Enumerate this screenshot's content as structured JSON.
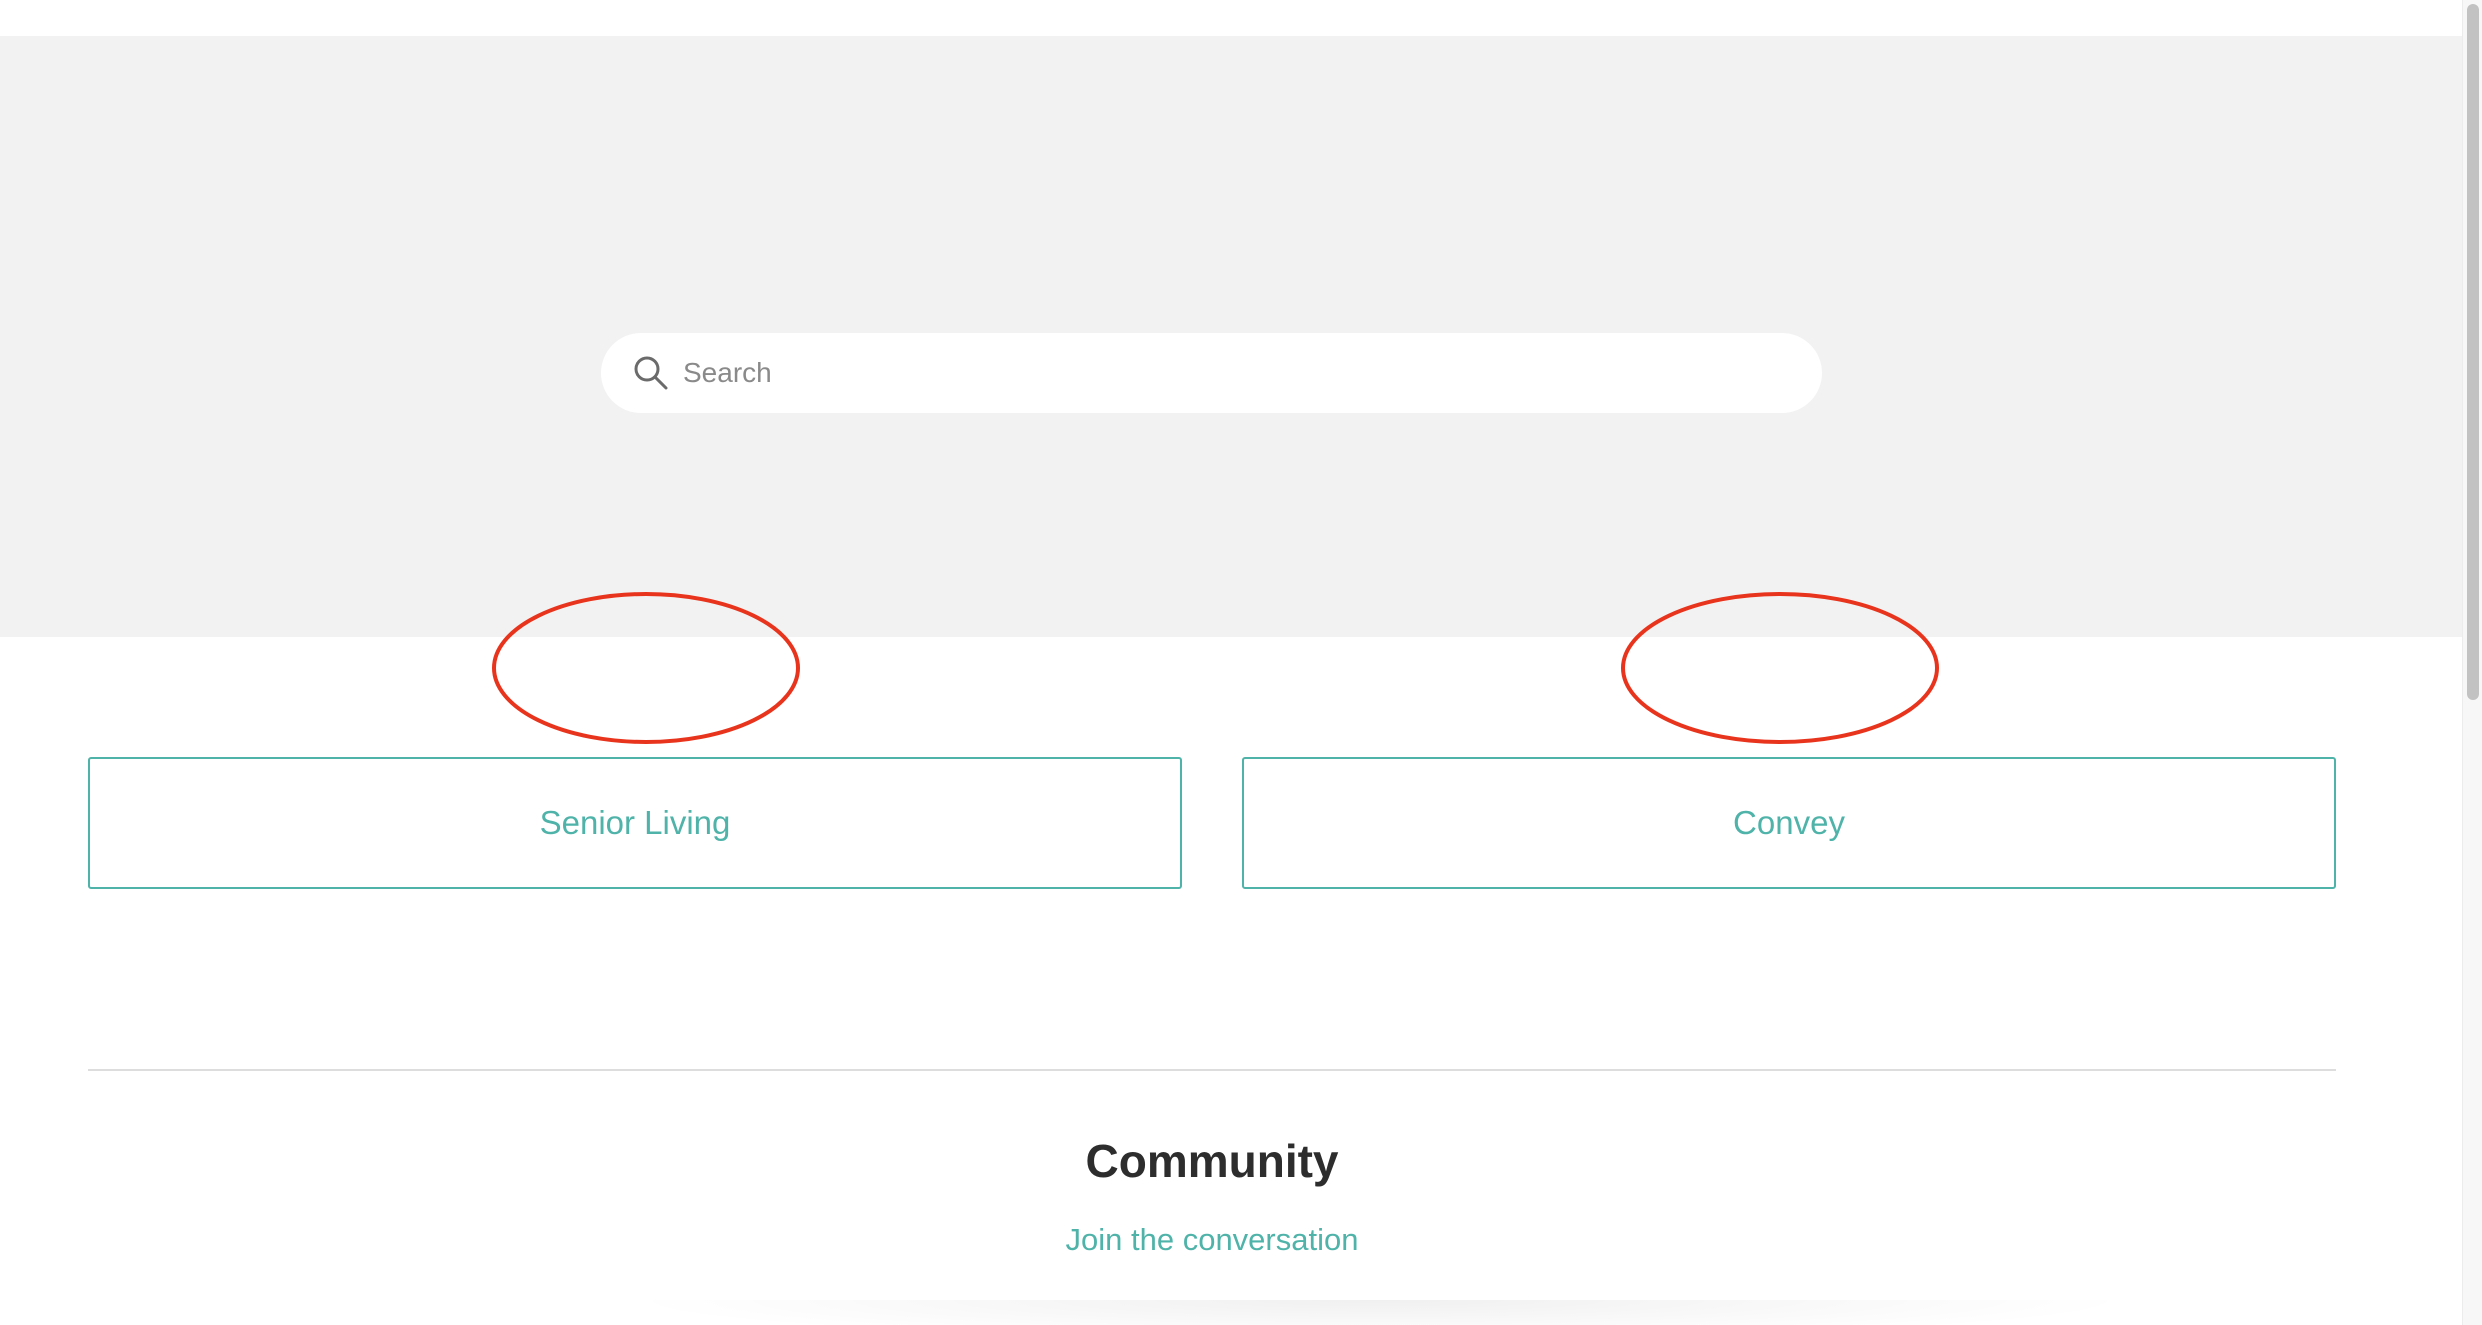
{
  "search": {
    "placeholder": "Search",
    "icon": "search-icon"
  },
  "categories": [
    {
      "label": "Senior Living"
    },
    {
      "label": "Convey"
    }
  ],
  "community": {
    "title": "Community",
    "link_label": "Join the conversation"
  },
  "colors": {
    "hero_background": "#f2f2f2",
    "accent": "#4fb3a9",
    "annotation": "#e8341c",
    "title_text": "#2d2d2d"
  }
}
